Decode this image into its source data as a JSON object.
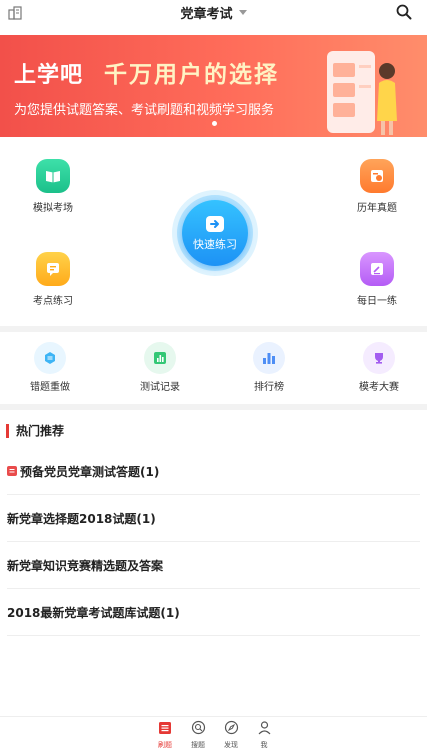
{
  "header": {
    "title": "党章考试",
    "left_icon": "building-icon",
    "right_icon": "search-icon"
  },
  "banner": {
    "title_part1": "上学吧",
    "title_part2": "千万用户的选择",
    "subtitle": "为您提供试题答案、考试刷题和视频学习服务"
  },
  "grid": {
    "mock_exam": "模拟考场",
    "past_exams": "历年真题",
    "quick_practice": "快速练习",
    "point_practice": "考点练习",
    "daily_practice": "每日一练"
  },
  "shortcuts": {
    "wrong_redo": "错题重做",
    "test_records": "测试记录",
    "leaderboard": "排行榜",
    "mock_contest": "模考大赛"
  },
  "hot": {
    "title": "热门推荐",
    "items": [
      "预备党员党章测试答题(1)",
      "新党章选择题2018试题(1)",
      "新党章知识竞赛精选题及答案",
      "2018最新党章考试题库试题(1)"
    ]
  },
  "tabbar": {
    "items": [
      "刷题",
      "搜题",
      "发现",
      "我"
    ],
    "active_index": 0
  },
  "colors": {
    "accent_red": "#e53935",
    "banner_start": "#f2504a",
    "quick_blue": "#1d92f5"
  }
}
